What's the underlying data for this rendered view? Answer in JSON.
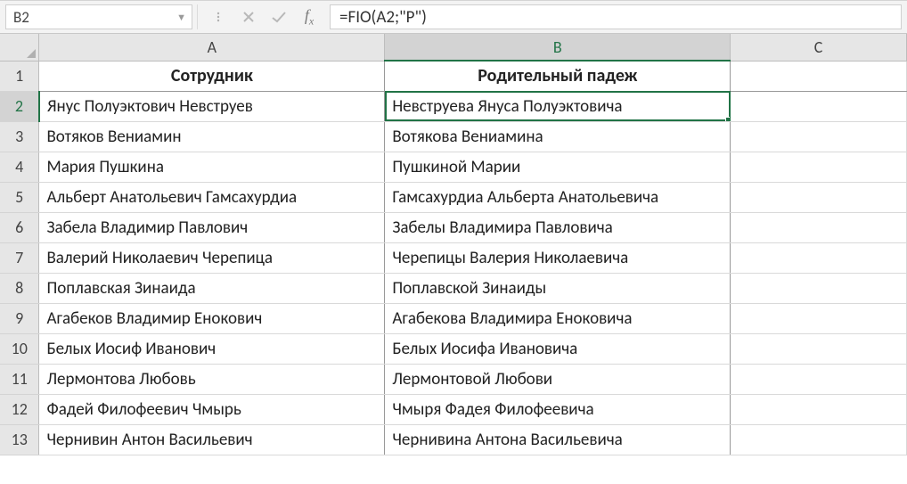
{
  "namebox": {
    "value": "B2"
  },
  "formula": {
    "value": "=FIO(A2;\"Р\")"
  },
  "columns": [
    "A",
    "B",
    "C"
  ],
  "headerRow": {
    "A": "Сотрудник",
    "B": "Родительный падеж"
  },
  "rows": [
    {
      "n": "1"
    },
    {
      "n": "2",
      "A": "Янус Полуэктович Невструев",
      "B": "Невструева Януса Полуэктовича"
    },
    {
      "n": "3",
      "A": "Вотяков Вениамин",
      "B": "Вотякова Вениамина"
    },
    {
      "n": "4",
      "A": "Мария Пушкина",
      "B": "Пушкиной Марии"
    },
    {
      "n": "5",
      "A": "Альберт Анатольевич Гамсахурдиа",
      "B": "Гамсахурдиа Альберта Анатольевича"
    },
    {
      "n": "6",
      "A": "Забела Владимир Павлович",
      "B": "Забелы Владимира Павловича"
    },
    {
      "n": "7",
      "A": "Валерий Николаевич Черепица",
      "B": "Черепицы Валерия Николаевича"
    },
    {
      "n": "8",
      "A": "Поплавская Зинаида",
      "B": "Поплавской Зинаиды"
    },
    {
      "n": "9",
      "A": "Агабеков Владимир Енокович",
      "B": "Агабекова Владимира Еноковича"
    },
    {
      "n": "10",
      "A": "Белых Иосиф Иванович",
      "B": "Белых Иосифа Ивановича"
    },
    {
      "n": "11",
      "A": "Лермонтова Любовь",
      "B": "Лермонтовой Любови"
    },
    {
      "n": "12",
      "A": "Фадей Филофеевич Чмырь",
      "B": "Чмыря Фадея Филофеевича"
    },
    {
      "n": "13",
      "A": "Чернивин Антон Васильевич",
      "B": "Чернивина Антона Васильевича"
    }
  ],
  "selection": {
    "cell": "B2",
    "row": "2",
    "col": "B"
  }
}
